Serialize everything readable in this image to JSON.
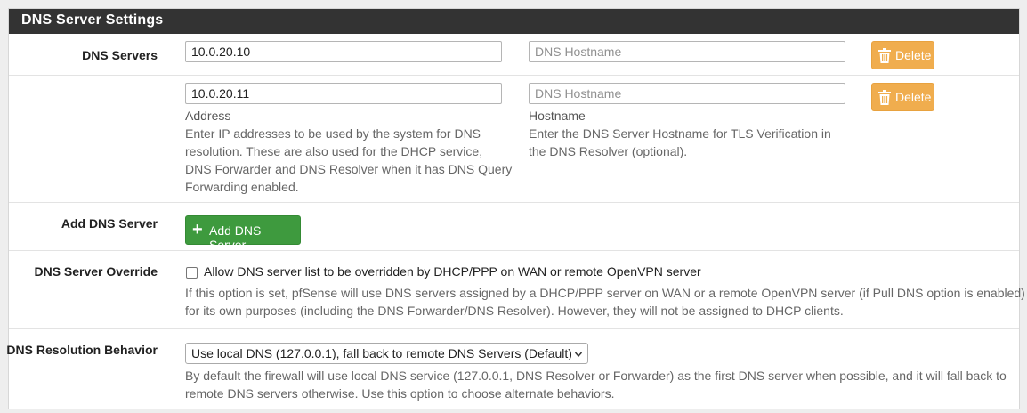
{
  "panel": {
    "title": "DNS Server Settings"
  },
  "dns_servers": {
    "label": "DNS Servers",
    "entries": [
      {
        "address": "10.0.20.10",
        "hostname_placeholder": "DNS Hostname",
        "delete_label": "Delete"
      },
      {
        "address": "10.0.20.11",
        "hostname_placeholder": "DNS Hostname",
        "delete_label": "Delete"
      }
    ],
    "address_label": "Address",
    "address_help_lines": [
      "Enter IP addresses to be used by the system for DNS",
      "resolution. These are also used for the DHCP service,",
      "DNS Forwarder and DNS Resolver when it has DNS Query",
      "Forwarding enabled."
    ],
    "hostname_label": "Hostname",
    "hostname_help_lines": [
      "Enter the DNS Server Hostname for TLS Verification in",
      "the DNS Resolver (optional)."
    ]
  },
  "add_dns": {
    "label": "Add DNS Server",
    "button_label": "Add DNS Server"
  },
  "override": {
    "label": "DNS Server Override",
    "checkbox_label": "Allow DNS server list to be overridden by DHCP/PPP on WAN or remote OpenVPN server",
    "checked": false,
    "help_lines": [
      "If this option is set, pfSense will use DNS servers assigned by a DHCP/PPP server on WAN or a remote OpenVPN server (if Pull DNS option is enabled)",
      "for its own purposes (including the DNS Forwarder/DNS Resolver). However, they will not be assigned to DHCP clients."
    ]
  },
  "resolution": {
    "label": "DNS Resolution Behavior",
    "selected": "Use local DNS (127.0.0.1), fall back to remote DNS Servers (Default)",
    "help_lines": [
      "By default the firewall will use local DNS service (127.0.0.1, DNS Resolver or Forwarder) as the first DNS server when possible, and it will fall back to",
      "remote DNS servers otherwise. Use this option to choose alternate behaviors."
    ]
  },
  "icons": {
    "delete": "trash-icon",
    "add": "plus-icon",
    "select": "chevron-down-icon"
  },
  "colors": {
    "header": "#333333",
    "delete_button": "#f0ad4e",
    "add_button": "#3e9a3e"
  }
}
